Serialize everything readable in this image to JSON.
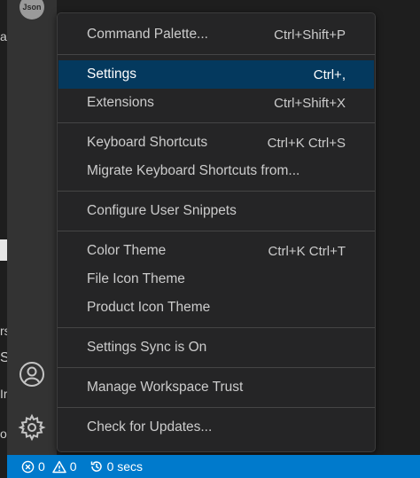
{
  "activity_bar": {
    "avatar_text": "Json",
    "account_icon": "account-icon",
    "settings_icon": "gear-icon"
  },
  "menu": {
    "items": [
      {
        "label": "Command Palette...",
        "shortcut": "Ctrl+Shift+P"
      },
      {
        "label": "Settings",
        "shortcut": "Ctrl+,",
        "active": true
      },
      {
        "label": "Extensions",
        "shortcut": "Ctrl+Shift+X"
      },
      {
        "label": "Keyboard Shortcuts",
        "shortcut": "Ctrl+K Ctrl+S"
      },
      {
        "label": "Migrate Keyboard Shortcuts from...",
        "shortcut": ""
      },
      {
        "label": "Configure User Snippets",
        "shortcut": ""
      },
      {
        "label": "Color Theme",
        "shortcut": "Ctrl+K Ctrl+T"
      },
      {
        "label": "File Icon Theme",
        "shortcut": ""
      },
      {
        "label": "Product Icon Theme",
        "shortcut": ""
      },
      {
        "label": "Settings Sync is On",
        "shortcut": ""
      },
      {
        "label": "Manage Workspace Trust",
        "shortcut": ""
      },
      {
        "label": "Check for Updates...",
        "shortcut": ""
      }
    ]
  },
  "status_bar": {
    "errors": "0",
    "warnings": "0",
    "timer": "0 secs"
  },
  "colors": {
    "menu_bg": "#252526",
    "active_item_bg": "#04395e",
    "status_bar_bg": "#007acc",
    "activity_bar_bg": "#333333"
  }
}
